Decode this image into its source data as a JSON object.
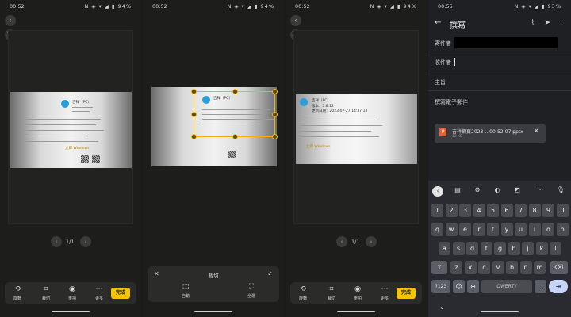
{
  "screens": [
    {
      "status": {
        "time": "00:52",
        "icons": "N ◈ ▾ ◢ ▮ 94%"
      },
      "doc": {
        "title": "吉祥（PC）",
        "footer": "立即 Windows"
      },
      "pager": {
        "page": "1/1"
      },
      "tools": [
        {
          "icon": "rotate-icon",
          "glyph": "⟲",
          "label": "旋轉"
        },
        {
          "icon": "crop-icon",
          "glyph": "⌗",
          "label": "裁切"
        },
        {
          "icon": "camera-icon",
          "glyph": "◉",
          "label": "重拍"
        },
        {
          "icon": "more-icon",
          "glyph": "⋯",
          "label": "更多"
        }
      ],
      "done_label": "完成"
    },
    {
      "status": {
        "time": "00:52",
        "icons": "N ◈ ▾ ◢ ▮ 94%"
      },
      "doc": {
        "title": "吉祥（PC）"
      },
      "crop": {
        "title": "裁切",
        "options": [
          {
            "icon": "auto-crop-icon",
            "glyph": "⬚",
            "label": "自動"
          },
          {
            "icon": "full-crop-icon",
            "glyph": "⛶",
            "label": "全選"
          }
        ]
      }
    },
    {
      "status": {
        "time": "00:52",
        "icons": "N ◈ ▾ ◢ ▮ 94%"
      },
      "doc": {
        "title": "吉祥（PC）",
        "meta1": "版本：3.8.12",
        "meta2": "更新日期：2023-07-27 14:37:13",
        "footer": "立即 Windows"
      },
      "pager": {
        "page": "1/1"
      },
      "tools": [
        {
          "icon": "rotate-icon",
          "glyph": "⟲",
          "label": "旋轉"
        },
        {
          "icon": "crop-icon",
          "glyph": "⌗",
          "label": "裁切"
        },
        {
          "icon": "camera-icon",
          "glyph": "◉",
          "label": "重拍"
        },
        {
          "icon": "more-icon",
          "glyph": "⋯",
          "label": "更多"
        }
      ],
      "done_label": "完成"
    }
  ],
  "email": {
    "status": {
      "time": "00:55",
      "icons": "N ◈ ▾ ◢ ▮ 93%"
    },
    "title": "撰寫",
    "from_label": "寄件者",
    "to_label": "收件者",
    "subject_placeholder": "主旨",
    "body_placeholder": "撰寫電子郵件",
    "attachment": {
      "name": "吉祥網頁2023-...00-52-07.pptx",
      "size": "12 KB"
    },
    "keyboard": {
      "suggestions": [
        "‹",
        "▤",
        "⚙",
        "◐",
        "◩",
        "⋯",
        "🎙"
      ],
      "row1": [
        "1",
        "2",
        "3",
        "4",
        "5",
        "6",
        "7",
        "8",
        "9",
        "0"
      ],
      "row2": [
        "q",
        "w",
        "e",
        "r",
        "t",
        "y",
        "u",
        "i",
        "o",
        "p"
      ],
      "row3": [
        "a",
        "s",
        "d",
        "f",
        "g",
        "h",
        "j",
        "k",
        "l"
      ],
      "row4": [
        "⇧",
        "z",
        "x",
        "c",
        "v",
        "b",
        "n",
        "m",
        "⌫"
      ],
      "row5": {
        "sym": "?123",
        "emoji": "☺",
        "globe": "⊕",
        "space": "QWERTY",
        "period": ".",
        "enter": "⇥"
      }
    }
  }
}
